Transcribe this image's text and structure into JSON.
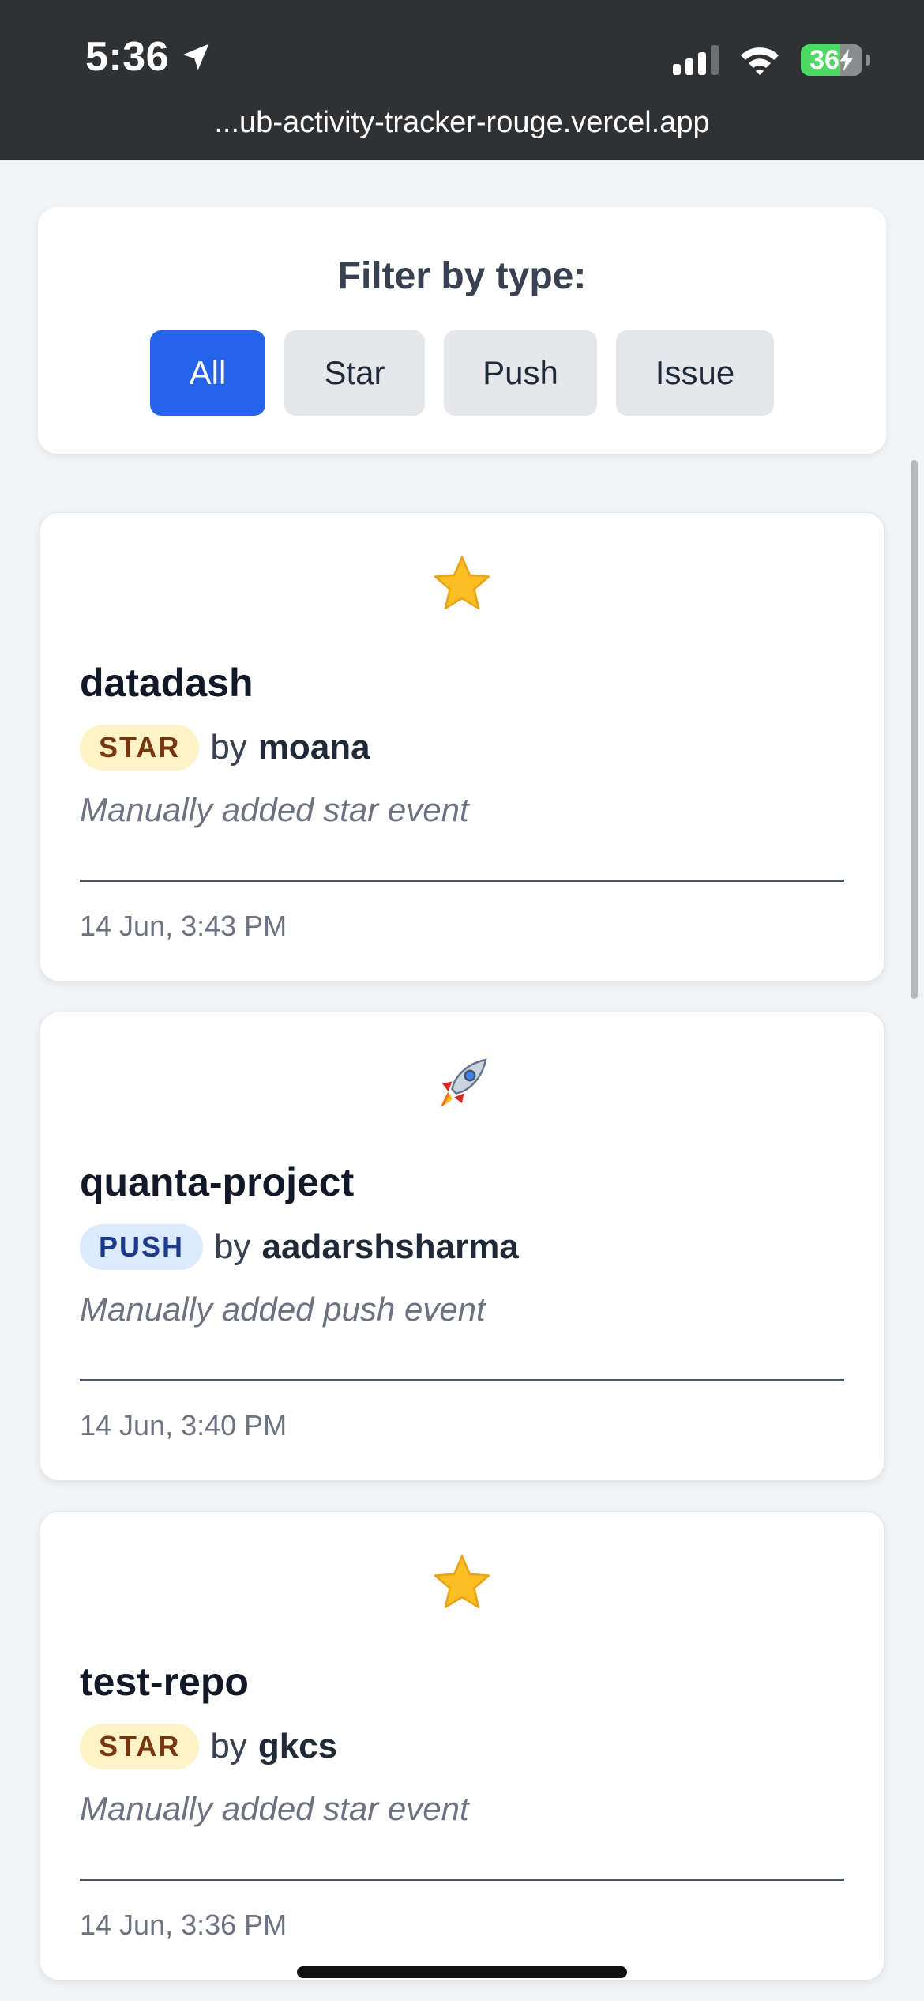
{
  "status_bar": {
    "time": "5:36",
    "battery": "36",
    "icons": [
      "location-arrow-icon",
      "signal-icon",
      "wifi-icon",
      "battery-charging-icon"
    ]
  },
  "browser": {
    "url": "...ub-activity-tracker-rouge.vercel.app"
  },
  "filter": {
    "title": "Filter by type:",
    "buttons": [
      "All",
      "Star",
      "Push",
      "Issue"
    ],
    "active": "All",
    "active_color": "#2563eb"
  },
  "events": [
    {
      "icon": "star-icon",
      "repo": "datadash",
      "type_label": "STAR",
      "by": "by",
      "user": "moana",
      "description": "Manually added star event",
      "timestamp": "14 Jun, 3:43 PM"
    },
    {
      "icon": "rocket-icon",
      "repo": "quanta-project",
      "type_label": "PUSH",
      "by": "by",
      "user": "aadarshsharma",
      "description": "Manually added push event",
      "timestamp": "14 Jun, 3:40 PM"
    },
    {
      "icon": "star-icon",
      "repo": "test-repo",
      "type_label": "STAR",
      "by": "by",
      "user": "gkcs",
      "description": "Manually added star event",
      "timestamp": "14 Jun, 3:36 PM"
    }
  ],
  "colors": {
    "star_badge_bg": "#fef3c7",
    "push_badge_bg": "#dbeafe"
  }
}
